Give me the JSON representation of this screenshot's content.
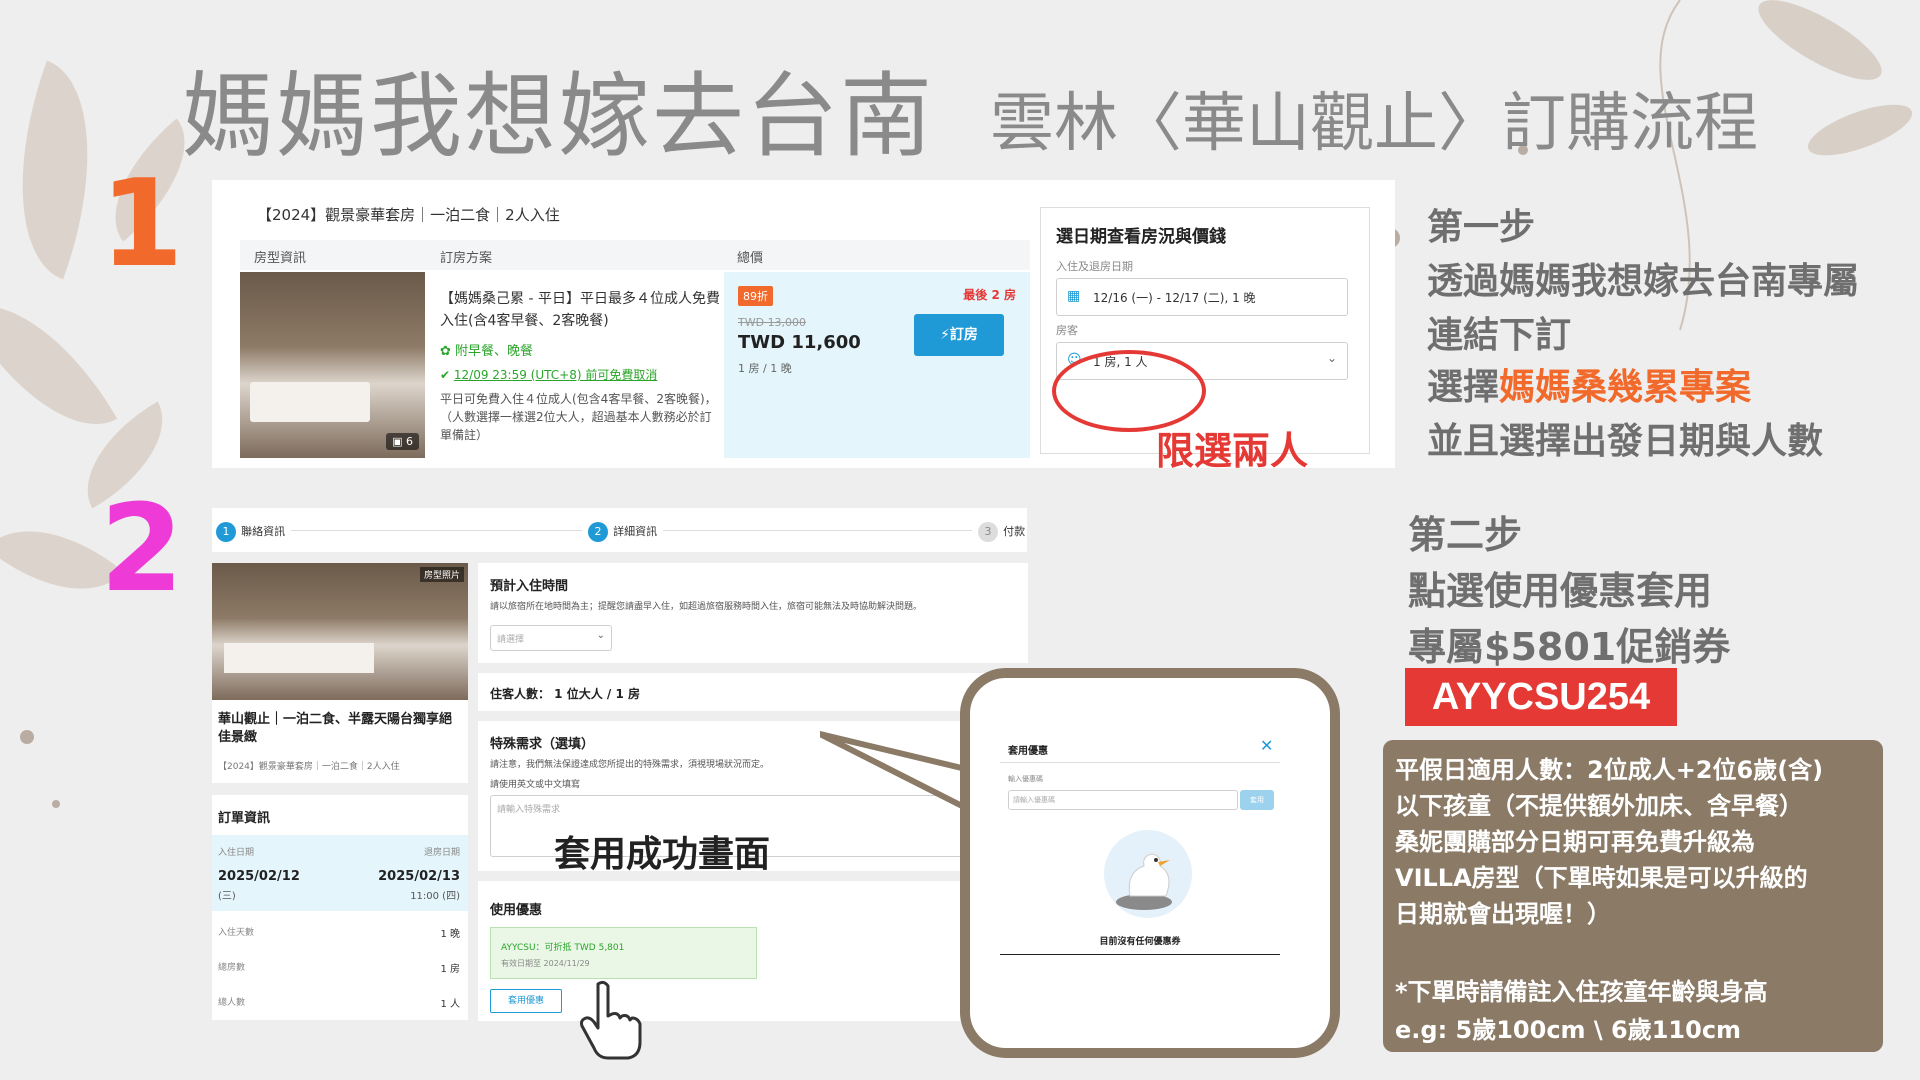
{
  "title": {
    "main": "媽媽我想嫁去台南",
    "sub": "雲林〈華山觀止〉訂購流程"
  },
  "steps": {
    "one": "1",
    "two": "2"
  },
  "room_panel": {
    "room_title": "【2024】觀景豪華套房｜一泊二食｜2人入住",
    "col_room": "房型資訊",
    "col_plan": "訂房方案",
    "col_total": "總價",
    "plan_name": "【媽媽桑己累 - 平日】平日最多４位成人免費入住(含4客早餐、2客晚餐)",
    "meal": "附早餐、晚餐",
    "cancel": "12/09 23:59 (UTC+8) 前可免費取消",
    "plan_note": "平日可免費入住４位成人(包含4客早餐、2客晚餐)，（人數選擇一樣選2位大人，超過基本人數務必於訂單備註）",
    "discount_badge": "89折",
    "last_rooms": "最後 2 房",
    "old_price": "TWD 13,000",
    "price": "TWD 11,600",
    "unit": "1 房 / 1 晚",
    "book_btn": "訂房",
    "photo_count": "6"
  },
  "date_panel": {
    "title": "選日期查看房況與價錢",
    "date_label": "入住及退房日期",
    "date_value": "12/16 (一) - 12/17 (二), 1 晚",
    "room_label": "房客",
    "room_value": "1 房, 1 人",
    "limit_note": "限選兩人"
  },
  "step1_text": {
    "l1": "第一步",
    "l2": "透過媽媽我想嫁去台南專屬",
    "l3": "連結下訂",
    "l4a": "選擇",
    "l4b": "媽媽桑幾累專案",
    "l5": "並且選擇出發日期與人數"
  },
  "checkout": {
    "progress": [
      {
        "num": "1",
        "label": "聯絡資訊"
      },
      {
        "num": "2",
        "label": "詳細資訊"
      },
      {
        "num": "3",
        "label": "付款"
      }
    ],
    "photo_tag": "房型照片",
    "hotel_name": "華山觀止｜一泊二食、半露天陽台獨享絕佳景緻",
    "hotel_sub": "【2024】觀景豪華套房｜一泊二食｜2人入住",
    "order_title": "訂單資訊",
    "checkin_label": "入住日期",
    "checkout_label": "退房日期",
    "checkin_date": "2025/02/12",
    "checkin_dow": "(三)",
    "checkout_date": "2025/02/13",
    "checkout_time": "11:00 (四)",
    "nights_label": "入住天數",
    "nights_val": "1 晚",
    "rooms_label": "總房數",
    "rooms_val": "1 房",
    "people_label": "總人數",
    "people_val": "1 人",
    "arrival_title": "預計入住時間",
    "arrival_note": "請以旅宿所在地時間為主；提醒您請盡早入住，如超過旅宿服務時間入住，旅宿可能無法及時協助解決問題。",
    "arrival_placeholder": "請選擇",
    "guests": "住客人數： 1 位大人 / 1 房",
    "special_title": "特殊需求（選填）",
    "special_note": "請注意，我們無法保證達成您所提出的特殊需求，須視現場狀況而定。",
    "special_lang": "請使用英文或中文填寫",
    "special_placeholder": "請輸入特殊需求",
    "success_label": "套用成功畫面",
    "promo_title": "使用優惠",
    "promo_applied": "AYYCSU：可折抵 TWD 5,801",
    "promo_valid": "有效日期至 2024/11/29",
    "promo_btn": "套用優惠"
  },
  "coupon_popup": {
    "title": "套用優惠",
    "input_label": "輸入優惠碼",
    "input_placeholder": "請輸入優惠碼",
    "apply_btn": "套用",
    "empty_text": "目前沒有任何優惠券"
  },
  "step2_text": {
    "l1": "第二步",
    "l2": "點選使用優惠套用",
    "l3": "專屬$5801促銷券",
    "code": "AYYCSU254"
  },
  "notes": {
    "n1": "平假日適用人數：2位成人+2位6歲(含)",
    "n2": "以下孩童（不提供額外加床、含早餐）",
    "n3": "桑妮團購部分日期可再免費升級為",
    "n4": "VILLA房型（下單時如果是可以升級的",
    "n5": "日期就會出現喔！）",
    "n6": "*下單時請備註入住孩童年齡與身高",
    "n7": "e.g: 5歲100cm \\ 6歲110cm"
  },
  "colors": {
    "step1": "#f26a2b",
    "step2": "#ee3bd8",
    "accent_red": "#e53935",
    "code_bg": "#e53935",
    "note_bg": "#8a7a66",
    "primary_blue": "#1f9ad6"
  }
}
